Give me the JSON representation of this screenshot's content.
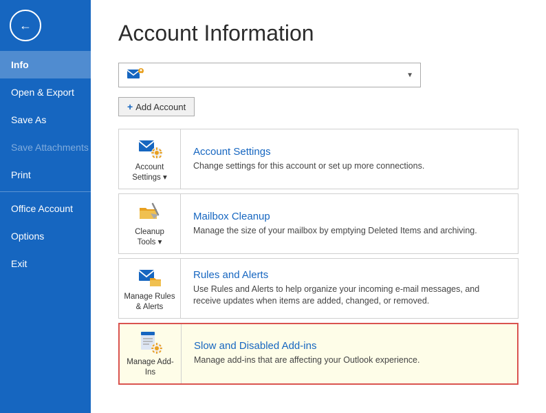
{
  "sidebar": {
    "back_btn_label": "←",
    "items": [
      {
        "id": "info",
        "label": "Info",
        "active": true,
        "disabled": false
      },
      {
        "id": "open-export",
        "label": "Open & Export",
        "active": false,
        "disabled": false
      },
      {
        "id": "save-as",
        "label": "Save As",
        "active": false,
        "disabled": false
      },
      {
        "id": "save-attachments",
        "label": "Save Attachments",
        "active": false,
        "disabled": true
      },
      {
        "id": "print",
        "label": "Print",
        "active": false,
        "disabled": false
      },
      {
        "id": "office-account",
        "label": "Office Account",
        "active": false,
        "disabled": false
      },
      {
        "id": "options",
        "label": "Options",
        "active": false,
        "disabled": false
      },
      {
        "id": "exit",
        "label": "Exit",
        "active": false,
        "disabled": false
      }
    ]
  },
  "main": {
    "page_title": "Account Information",
    "dropdown": {
      "placeholder": ""
    },
    "add_account_label": " Add Account",
    "add_icon": "+",
    "cards": [
      {
        "id": "account-settings",
        "icon_label": "Account Settings ▾",
        "title": "Account Settings",
        "desc": "Change settings for this account or set up more connections.",
        "highlighted": false
      },
      {
        "id": "mailbox-cleanup",
        "icon_label": "Cleanup Tools ▾",
        "title": "Mailbox Cleanup",
        "desc": "Manage the size of your mailbox by emptying Deleted Items and archiving.",
        "highlighted": false
      },
      {
        "id": "rules-alerts",
        "icon_label": "Manage Rules & Alerts",
        "title": "Rules and Alerts",
        "desc": "Use Rules and Alerts to help organize your incoming e-mail messages, and receive updates when items are added, changed, or removed.",
        "highlighted": false
      },
      {
        "id": "slow-disabled-addins",
        "icon_label": "Manage Add-Ins",
        "title": "Slow and Disabled Add-ins",
        "desc": "Manage add-ins that are affecting your Outlook experience.",
        "highlighted": true
      }
    ]
  }
}
